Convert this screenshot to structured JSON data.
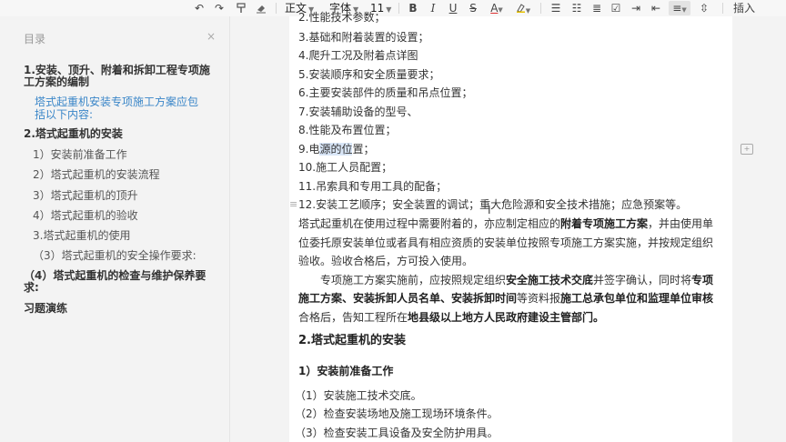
{
  "toolbar": {
    "style_select": "正文",
    "font_select": "字体",
    "size_select": "11",
    "bold": "B",
    "italic": "I",
    "underline": "U",
    "strike": "S",
    "font_color": "A",
    "insert_label": "插入"
  },
  "sidebar": {
    "title": "目录",
    "close": "×",
    "items": [
      {
        "label": "1.安装、顶升、附着和拆卸工程专项施"
      },
      {
        "label": "工方案的编制"
      },
      {
        "label": "塔式起重机安装专项施工方案应包"
      },
      {
        "label": "括以下内容:"
      },
      {
        "label": "2.塔式起重机的安装"
      },
      {
        "label": "1）安装前准备工作"
      },
      {
        "label": "2）塔式起重机的安装流程"
      },
      {
        "label": "3）塔式起重机的顶升"
      },
      {
        "label": "4）塔式起重机的验收"
      },
      {
        "label": "3.塔式起重机的使用"
      },
      {
        "label": "（3）塔式起重机的安全操作要求:"
      },
      {
        "label": "（4）塔式起重机的检查与维护保养要"
      },
      {
        "label": "求:"
      },
      {
        "label": "习题演练"
      }
    ]
  },
  "doc": {
    "l0": "2.性能技术参数；",
    "l1": "3.基础和附着装置的设置；",
    "l2": "4.爬升工况及附着点详图",
    "l3": "5.安装顺序和安全质量要求；",
    "l4": "6.主要安装部件的质量和吊点位置；",
    "l5": "7.安装辅助设备的型号、",
    "l6": "8.性能及布置位置；",
    "l7a": "9.电",
    "l7b": "源的位",
    "l7c": "置；",
    "l8": "10.施工人员配置；",
    "l9": "11.吊索具和专用工具的配备；",
    "l10": "12.安装工艺顺序；安全装置的调试；重大危险源和安全技术措施；应急预案等。",
    "p1a": "塔式起重机在使用过程中需要附着的，亦应制定相应的",
    "p1b": "附着专项施工方案",
    "p1c": "，并由使用单",
    "p2": "位委托原安装单位或者具有相应资质的安装单位按照专项施工方案实施，并按规定组织",
    "p3": "验收。验收合格后，方可投入使用。",
    "p4a": "专项施工方案实施前，应按照规定组织",
    "p4b": "安全施工技术交底",
    "p4c": "并签字确认，同时将",
    "p4d": "专项",
    "p5a": "施工方案、安装拆卸人员名单、安装拆卸时间",
    "p5b": "等资料报",
    "p5c": "施工总承包单位和监理单位审核",
    "p6a": "合格后，告知工程所在",
    "p6b": "地县级以上地方人民政府建设主管部门。",
    "h1": "2.塔式起重机的安装",
    "h2": "1）安装前准备工作",
    "s1": "（1）安装施工技术交底。",
    "s2": "（2）检查安装场地及施工现场环境条件。",
    "s3": "（3）检查安装工具设备及安全防护用具。"
  }
}
